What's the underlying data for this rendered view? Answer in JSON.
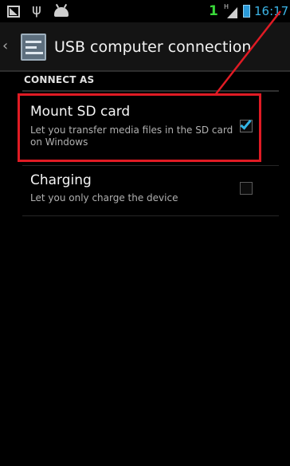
{
  "status_bar": {
    "notification_count": "1",
    "time": "16:17",
    "icons": [
      "screenshot-icon",
      "usb-icon",
      "android-debug-icon",
      "signal-icon",
      "battery-icon"
    ]
  },
  "action_bar": {
    "title": "USB computer connection",
    "back_icon": "chevron-left-icon",
    "app_icon": "settings-icon"
  },
  "section": {
    "header": "CONNECT AS"
  },
  "options": [
    {
      "title": "Mount SD card",
      "summary": "Let you transfer media files in the SD card on Windows",
      "checked": true
    },
    {
      "title": "Charging",
      "summary": "Let you only charge the device",
      "checked": false
    }
  ],
  "colors": {
    "accent": "#33b5e5",
    "annotation": "#e01b24",
    "notification": "#39d839"
  }
}
